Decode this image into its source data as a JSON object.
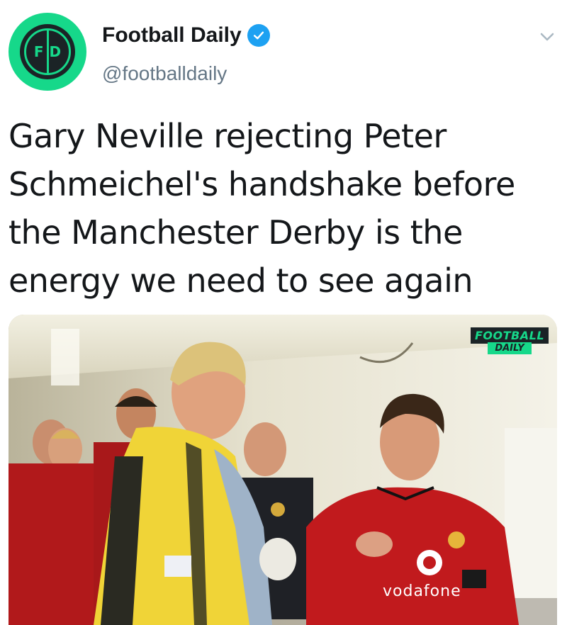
{
  "account": {
    "display_name": "Football Daily",
    "handle": "@footballdaily",
    "verified": true,
    "avatar_text": "FD"
  },
  "tweet": {
    "text": "Gary Neville rejecting Peter Schmeichel's handshake before the Manchester Derby is the energy we need to see again"
  },
  "media": {
    "watermark_line1": "FOOTBALL",
    "watermark_line2": "DAILY",
    "shirt_sponsor": "vodafone"
  },
  "icons": {
    "verified": "verified-badge-icon",
    "menu": "chevron-down-icon"
  },
  "colors": {
    "brand_green": "#16d88a",
    "verified_blue": "#1da1f2",
    "handle_gray": "#657786",
    "text": "#14171a"
  }
}
